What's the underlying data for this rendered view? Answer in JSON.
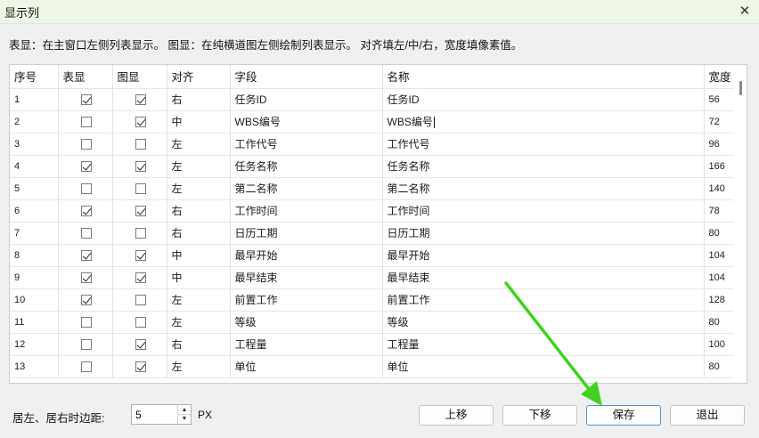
{
  "window": {
    "title": "显示列"
  },
  "description": "表显：在主窗口左侧列表显示。 图显：在纯横道图左侧绘制列表显示。 对齐填左/中/右，宽度填像素值。",
  "columns": [
    "序号",
    "表显",
    "图显",
    "对齐",
    "字段",
    "名称",
    "宽度"
  ],
  "rows": [
    {
      "seq": "1",
      "table_show": true,
      "chart_show": true,
      "align": "右",
      "field": "任务ID",
      "name": "任务ID",
      "width": "56"
    },
    {
      "seq": "2",
      "table_show": false,
      "chart_show": true,
      "align": "中",
      "field": "WBS编号",
      "name": "WBS编号",
      "width": "72"
    },
    {
      "seq": "3",
      "table_show": false,
      "chart_show": false,
      "align": "左",
      "field": "工作代号",
      "name": "工作代号",
      "width": "96"
    },
    {
      "seq": "4",
      "table_show": true,
      "chart_show": true,
      "align": "左",
      "field": "任务名称",
      "name": "任务名称",
      "width": "166"
    },
    {
      "seq": "5",
      "table_show": false,
      "chart_show": false,
      "align": "左",
      "field": "第二名称",
      "name": "第二名称",
      "width": "140"
    },
    {
      "seq": "6",
      "table_show": true,
      "chart_show": true,
      "align": "右",
      "field": "工作时间",
      "name": "工作时间",
      "width": "78"
    },
    {
      "seq": "7",
      "table_show": false,
      "chart_show": false,
      "align": "右",
      "field": "日历工期",
      "name": "日历工期",
      "width": "80"
    },
    {
      "seq": "8",
      "table_show": true,
      "chart_show": true,
      "align": "中",
      "field": "最早开始",
      "name": "最早开始",
      "width": "104"
    },
    {
      "seq": "9",
      "table_show": true,
      "chart_show": true,
      "align": "中",
      "field": "最早结束",
      "name": "最早结束",
      "width": "104"
    },
    {
      "seq": "10",
      "table_show": true,
      "chart_show": false,
      "align": "左",
      "field": "前置工作",
      "name": "前置工作",
      "width": "128"
    },
    {
      "seq": "11",
      "table_show": false,
      "chart_show": false,
      "align": "左",
      "field": "等级",
      "name": "等级",
      "width": "80"
    },
    {
      "seq": "12",
      "table_show": false,
      "chart_show": true,
      "align": "右",
      "field": "工程量",
      "name": "工程量",
      "width": "100"
    },
    {
      "seq": "13",
      "table_show": false,
      "chart_show": true,
      "align": "左",
      "field": "单位",
      "name": "单位",
      "width": "80"
    }
  ],
  "footer": {
    "margin_label": "居左、居右时边距:",
    "margin_value": "5",
    "unit": "PX",
    "buttons": {
      "up": "上移",
      "down": "下移",
      "save": "保存",
      "exit": "退出"
    }
  },
  "icons": {
    "close": "close-icon",
    "spin_up": "triangle-up-icon",
    "spin_down": "triangle-down-icon"
  },
  "colors": {
    "titlebar_bg": "#eef6e6",
    "annotation_arrow": "#3fd31f",
    "primary_border": "#5a8fd6"
  }
}
